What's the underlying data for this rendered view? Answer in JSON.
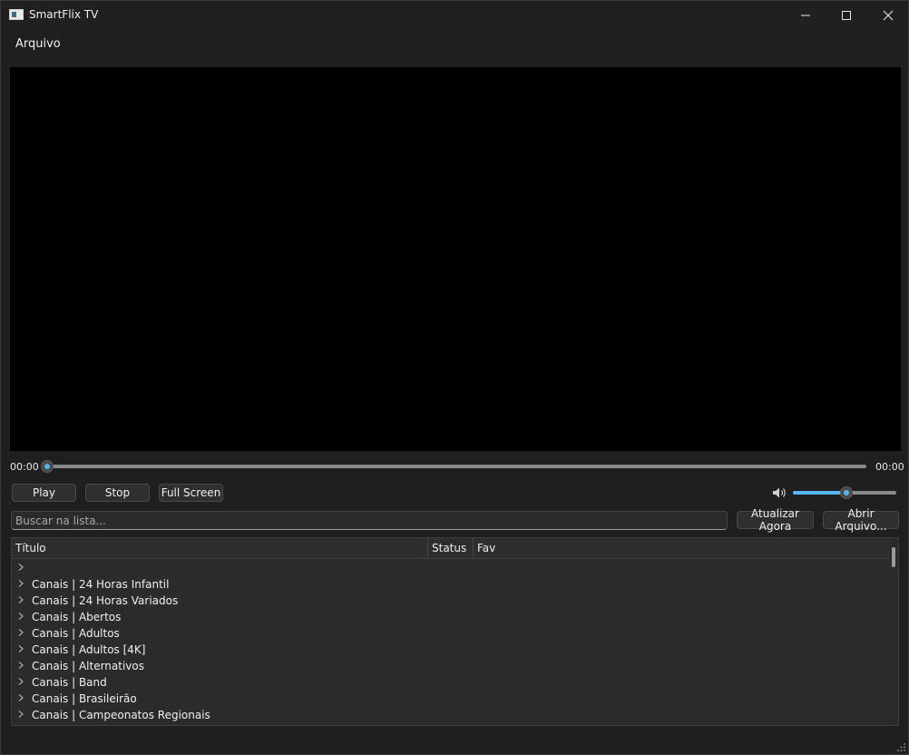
{
  "window": {
    "title": "SmartFlix TV"
  },
  "menu": {
    "items": [
      {
        "label": "Arquivo"
      }
    ]
  },
  "player": {
    "time_current": "00:00",
    "time_total": "00:00",
    "progress": 0,
    "volume": 0.52,
    "buttons": {
      "play": "Play",
      "stop": "Stop",
      "fullscreen": "Full Screen"
    }
  },
  "search": {
    "placeholder": "Buscar na lista...",
    "value": ""
  },
  "actions": {
    "update": "Atualizar Agora",
    "open": "Abrir Arquivo..."
  },
  "tree": {
    "columns": {
      "title": "Título",
      "status": "Status",
      "fav": "Fav"
    },
    "rows": [
      {
        "label": ""
      },
      {
        "label": "Canais | 24 Horas Infantil"
      },
      {
        "label": "Canais | 24 Horas Variados"
      },
      {
        "label": "Canais | Abertos"
      },
      {
        "label": "Canais | Adultos"
      },
      {
        "label": "Canais | Adultos [4K]"
      },
      {
        "label": "Canais | Alternativos"
      },
      {
        "label": "Canais | Band"
      },
      {
        "label": "Canais | Brasileirão"
      },
      {
        "label": "Canais | Campeonatos Regionais"
      }
    ]
  },
  "colors": {
    "accent": "#58b4f0",
    "background": "#1f1f1f",
    "video": "#000000"
  },
  "icons": [
    "app-icon",
    "minimize-icon",
    "maximize-icon",
    "close-icon",
    "volume-icon",
    "chevron-right-icon",
    "resize-grip-icon"
  ]
}
